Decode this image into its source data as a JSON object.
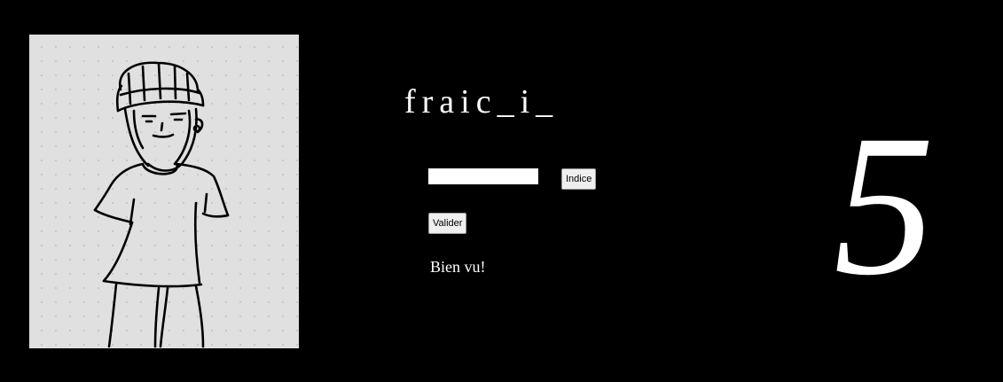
{
  "drawing": {
    "icon": "character-drawing"
  },
  "puzzle": {
    "word": "fraic_i_"
  },
  "answer": {
    "value": "",
    "placeholder": ""
  },
  "buttons": {
    "hint_label": "Indice",
    "validate_label": "Valider"
  },
  "feedback": {
    "message": "Bien vu!"
  },
  "level": {
    "number": "5"
  },
  "colors": {
    "background": "#000000",
    "text": "#ffffff",
    "panel": "#e0e0e0"
  }
}
